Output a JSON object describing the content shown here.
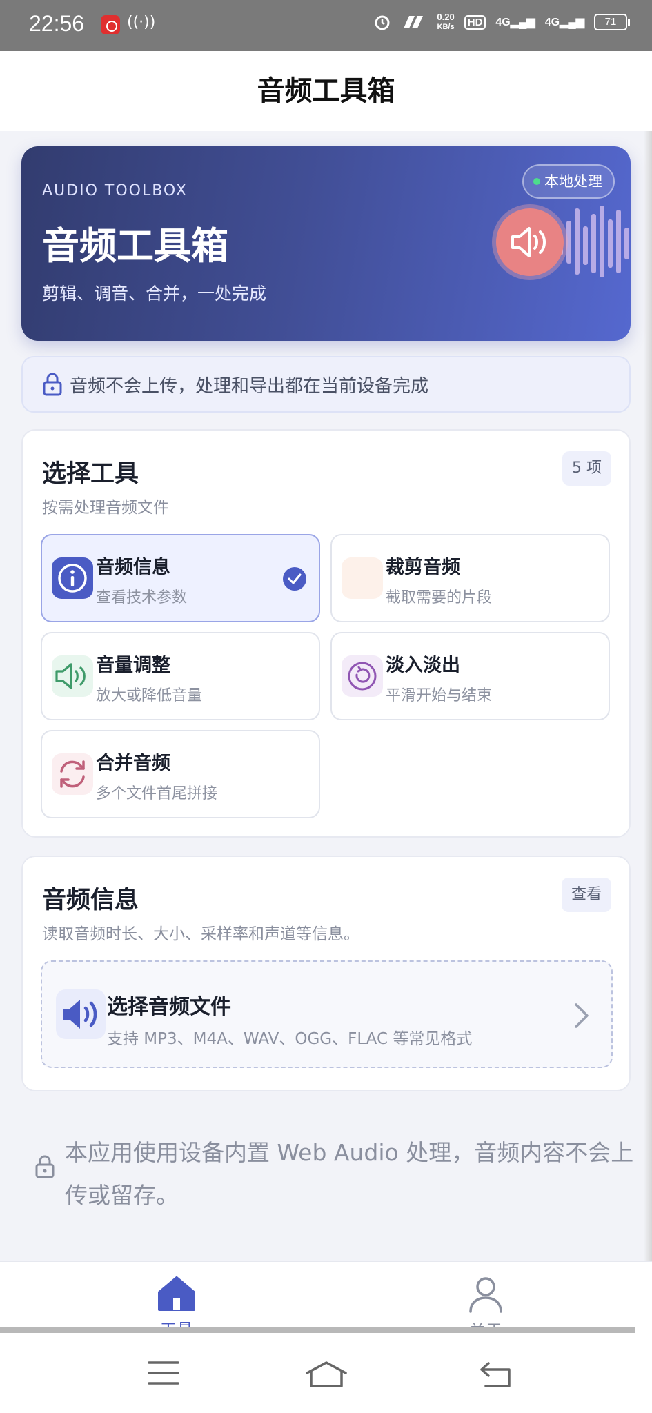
{
  "status_bar": {
    "time": "22:56",
    "net_rate_value": "0.20",
    "net_rate_unit": "KB/s",
    "hd": "HD",
    "sim1": "4G",
    "sim2": "4G",
    "battery": "71"
  },
  "header": {
    "title": "音频工具箱"
  },
  "hero": {
    "kicker": "AUDIO TOOLBOX",
    "title": "音频工具箱",
    "subtitle": "剪辑、调音、合并，一处完成",
    "badge": "本地处理"
  },
  "privacy_note": "音频不会上传，处理和导出都在当前设备完成",
  "tools_card": {
    "title": "选择工具",
    "count": "5 项",
    "subtitle": "按需处理音频文件",
    "tools": [
      {
        "name": "音频信息",
        "desc": "查看技术参数",
        "icon": "info-icon",
        "selected": true
      },
      {
        "name": "裁剪音频",
        "desc": "截取需要的片段",
        "icon": "scissors-icon",
        "selected": false
      },
      {
        "name": "音量调整",
        "desc": "放大或降低音量",
        "icon": "volume-icon",
        "selected": false
      },
      {
        "name": "淡入淡出",
        "desc": "平滑开始与结束",
        "icon": "fade-icon",
        "selected": false
      },
      {
        "name": "合并音频",
        "desc": "多个文件首尾拼接",
        "icon": "merge-icon",
        "selected": false
      }
    ]
  },
  "info_card": {
    "title": "音频信息",
    "action": "查看",
    "subtitle": "读取音频时长、大小、采样率和声道等信息。",
    "picker_title": "选择音频文件",
    "picker_sub": "支持 MP3、M4A、WAV、OGG、FLAC 等常见格式"
  },
  "footer_note": "本应用使用设备内置 Web Audio 处理，音频内容不会上传或留存。",
  "bottom_nav": {
    "tools": "工具",
    "about": "关于"
  },
  "colors": {
    "accent": "#4a5bc4",
    "hero_start": "#323c6f",
    "hero_end": "#5568cf"
  }
}
